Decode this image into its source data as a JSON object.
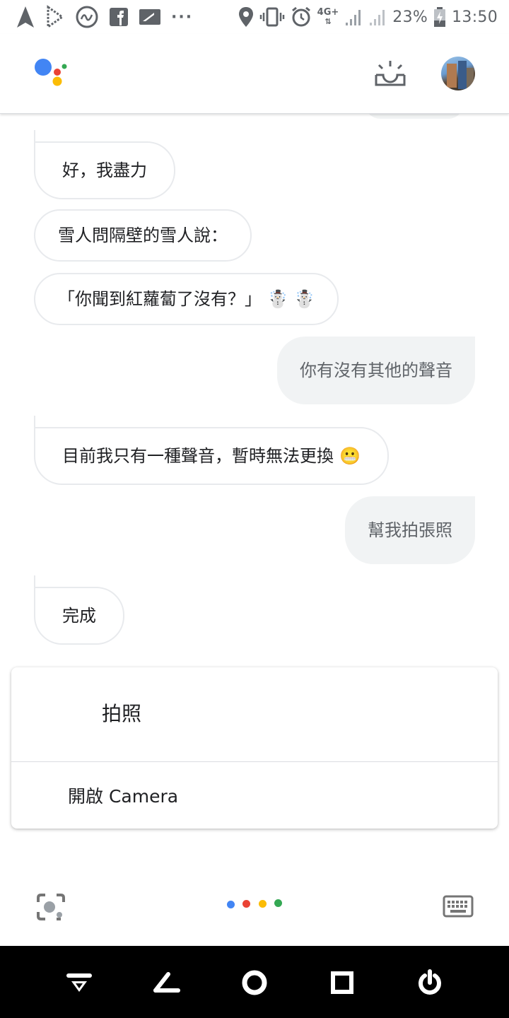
{
  "status_bar": {
    "network_label": "4G+",
    "battery": "23%",
    "time": "13:50",
    "overflow": "···",
    "icons": [
      "navigation-icon",
      "play-store-icon",
      "gesture-icon",
      "facebook-icon",
      "notification-icon",
      "location-icon",
      "vibrate-icon",
      "alarm-icon",
      "signal-icon",
      "battery-charging-icon"
    ]
  },
  "app_bar": {
    "logo": "google-assistant-logo",
    "updates_icon": "updates-icon",
    "avatar": "account-avatar"
  },
  "conversation": {
    "messages": [
      {
        "role": "assistant",
        "text": "好，我盡力"
      },
      {
        "role": "assistant",
        "text": "雪人問隔壁的雪人說："
      },
      {
        "role": "assistant",
        "text": "「你聞到紅蘿蔔了沒有？」",
        "emoji": "☃️ ☃️"
      },
      {
        "role": "user",
        "text": "你有沒有其他的聲音"
      },
      {
        "role": "assistant",
        "text": "目前我只有一種聲音，暫時無法更換",
        "emoji": "😬"
      },
      {
        "role": "user",
        "text": "幫我拍張照"
      },
      {
        "role": "assistant",
        "text": "完成"
      }
    ]
  },
  "result_card": {
    "title": "拍照",
    "action_label": "開啟 Camera"
  },
  "bottom_bar": {
    "lens_icon": "lens-icon",
    "keyboard_icon": "keyboard-icon",
    "dots_colors": [
      "#4285F4",
      "#EA4335",
      "#FBBC05",
      "#34A853"
    ]
  },
  "nav_bar": {
    "buttons": [
      "notification-pull-icon",
      "back-icon",
      "home-icon",
      "recents-icon",
      "power-icon"
    ]
  },
  "colors": {
    "assistant_blue": "#4285F4",
    "assistant_red": "#EA4335",
    "assistant_yellow": "#FBBC05",
    "assistant_green": "#34A853",
    "user_bubble": "#F1F3F4",
    "bubble_border": "#E8EAED"
  }
}
